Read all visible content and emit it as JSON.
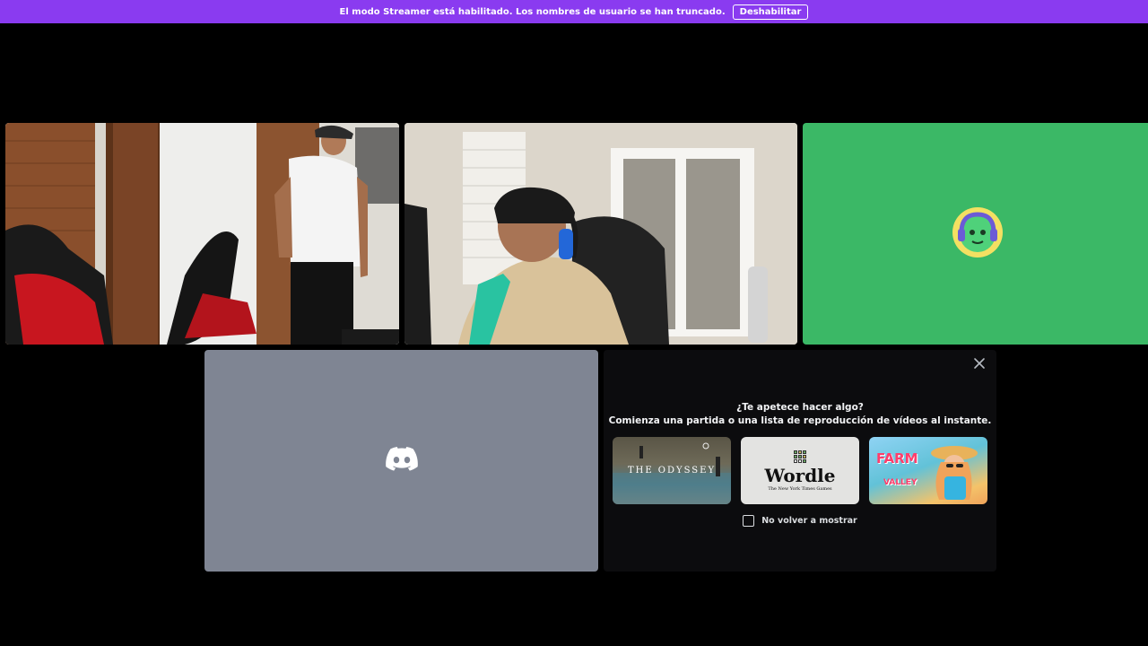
{
  "banner": {
    "message": "El modo Streamer está habilitado. Los nombres de usuario se han truncado.",
    "button_label": "Deshabilitar"
  },
  "colors": {
    "banner": "#8a3bf0",
    "avatar_tile": "#3bb866",
    "placeholder_tile": "#7f8593",
    "panel": "#0c0c0e"
  },
  "tiles": [
    {
      "kind": "video"
    },
    {
      "kind": "video"
    },
    {
      "kind": "avatar",
      "icon": "user-avatar-icon"
    },
    {
      "kind": "placeholder",
      "icon": "discord-logo-icon"
    }
  ],
  "activity_panel": {
    "title": "¿Te apetece hacer algo?",
    "subtitle": "Comienza una partida o una lista de reproducción de vídeos al instante.",
    "cards": [
      {
        "title": "THE ODYSSEY"
      },
      {
        "title": "Wordle",
        "subtitle": "The New York Times Games"
      },
      {
        "title": "FARM",
        "subtitle": "VALLEY"
      }
    ],
    "checkbox_label": "No volver a mostrar",
    "checked": false
  }
}
